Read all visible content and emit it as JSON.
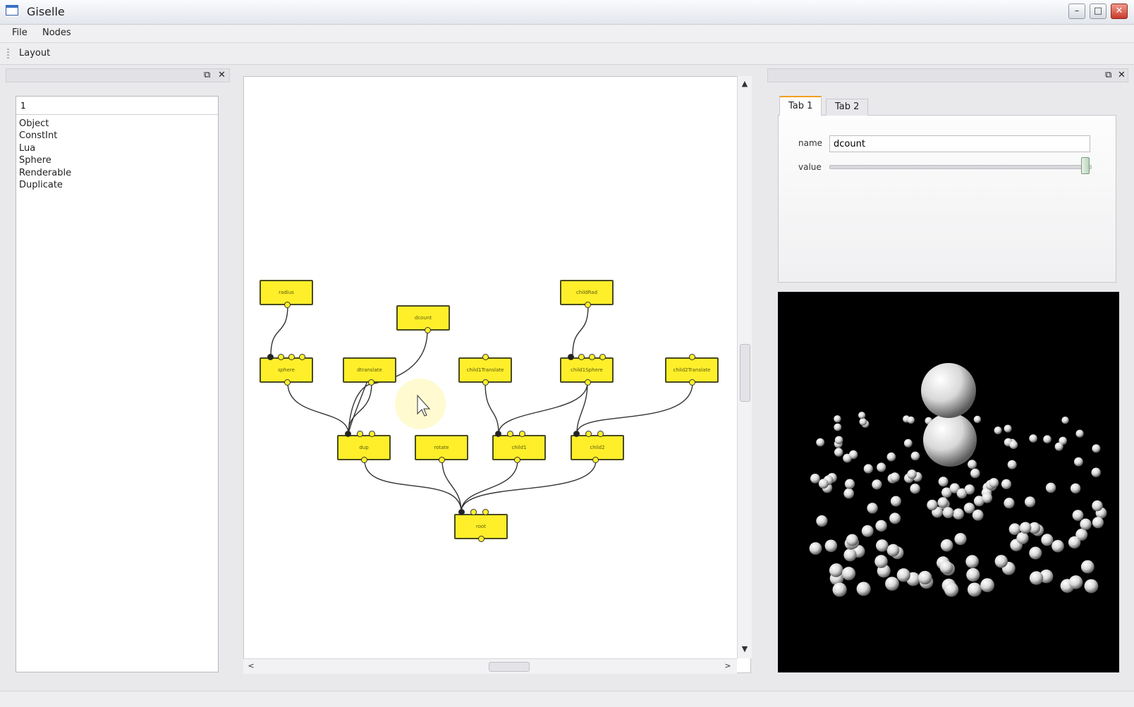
{
  "window": {
    "title": "Giselle",
    "minimize": "–",
    "maximize": "□",
    "close": "✕"
  },
  "menu": {
    "items": [
      "File",
      "Nodes"
    ]
  },
  "toolbar": {
    "layout_label": "Layout"
  },
  "dock": {
    "float_icon": "⧉",
    "close_icon": "✕"
  },
  "node_list": {
    "filter_value": "1",
    "items": [
      "Object",
      "ConstInt",
      "Lua",
      "Sphere",
      "Renderable",
      "Duplicate"
    ]
  },
  "scroll": {
    "up": "▲",
    "down": "▼",
    "left": "<",
    "right": ">"
  },
  "graph": {
    "nodes": [
      {
        "label": "radius"
      },
      {
        "label": "dcount"
      },
      {
        "label": "childRad"
      },
      {
        "label": "sphere"
      },
      {
        "label": "dtranslate"
      },
      {
        "label": "child1Translate"
      },
      {
        "label": "child1Sphere"
      },
      {
        "label": "child2Translate"
      },
      {
        "label": "dup"
      },
      {
        "label": "rotate"
      },
      {
        "label": "child1"
      },
      {
        "label": "child2"
      },
      {
        "label": "root"
      }
    ]
  },
  "properties": {
    "tabs": [
      "Tab 1",
      "Tab 2"
    ],
    "name_label": "name",
    "name_value": "dcount",
    "value_label": "value",
    "slider_fraction": 0.98
  },
  "colors": {
    "node_fill": "#ffef2a",
    "tab_accent": "#f0a020",
    "viewport_bg": "#000000"
  }
}
